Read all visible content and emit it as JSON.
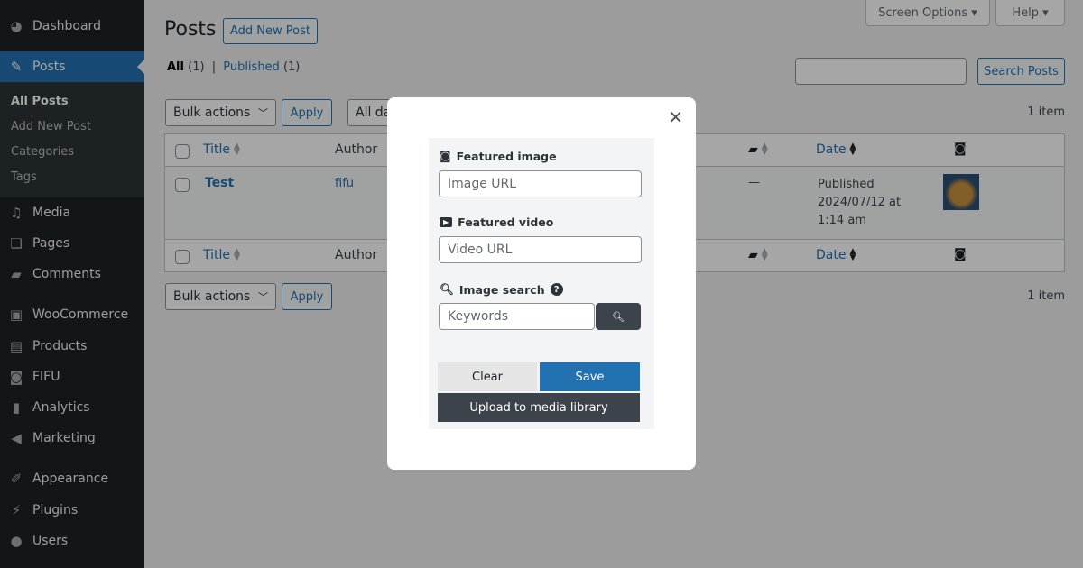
{
  "sidebar": {
    "items": [
      {
        "label": "Dashboard",
        "icon": "dashboard-icon"
      },
      {
        "label": "Posts",
        "icon": "pin-icon",
        "active": true
      },
      {
        "label": "Media",
        "icon": "media-icon"
      },
      {
        "label": "Pages",
        "icon": "pages-icon"
      },
      {
        "label": "Comments",
        "icon": "comment-icon"
      },
      {
        "label": "WooCommerce",
        "icon": "woo-icon"
      },
      {
        "label": "Products",
        "icon": "archive-icon"
      },
      {
        "label": "FIFU",
        "icon": "camera-icon"
      },
      {
        "label": "Analytics",
        "icon": "bar-chart-icon"
      },
      {
        "label": "Marketing",
        "icon": "megaphone-icon"
      },
      {
        "label": "Appearance",
        "icon": "brush-icon"
      },
      {
        "label": "Plugins",
        "icon": "plugin-icon"
      },
      {
        "label": "Users",
        "icon": "user-icon"
      }
    ],
    "submenu": [
      "All Posts",
      "Add New Post",
      "Categories",
      "Tags"
    ]
  },
  "header": {
    "screen_options": "Screen Options",
    "help": "Help",
    "title": "Posts",
    "add_new": "Add New Post"
  },
  "filters": {
    "all": "All",
    "all_count": "(1)",
    "sep": "|",
    "published": "Published",
    "published_count": "(1)"
  },
  "search": {
    "value": "",
    "button": "Search Posts"
  },
  "toolbar": {
    "bulk_actions": "Bulk actions",
    "apply": "Apply",
    "dates": "All dates",
    "count": "1 item"
  },
  "table": {
    "columns": {
      "title": "Title",
      "author": "Author",
      "date": "Date"
    },
    "rows": [
      {
        "title": "Test",
        "author": "fifu",
        "comments": "—",
        "status": "Published",
        "date": "2024/07/12 at 1:14 am"
      }
    ]
  },
  "modal": {
    "featured_image": {
      "label": "Featured image",
      "placeholder": "Image URL"
    },
    "featured_video": {
      "label": "Featured video",
      "placeholder": "Video URL"
    },
    "image_search": {
      "label": "Image search",
      "placeholder": "Keywords"
    },
    "clear": "Clear",
    "save": "Save",
    "upload": "Upload to media library",
    "accent": "#2271b1",
    "dark": "#3c434a"
  }
}
